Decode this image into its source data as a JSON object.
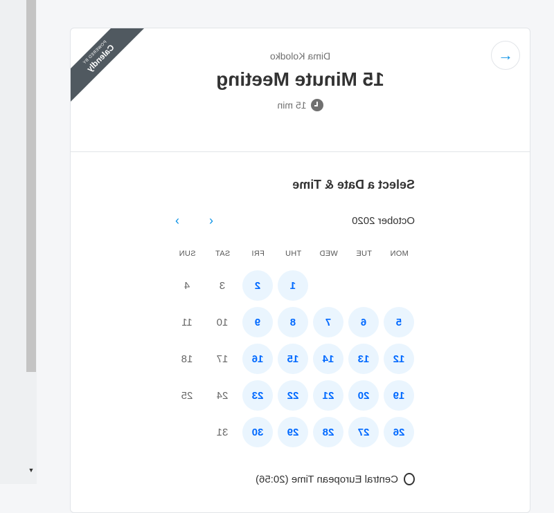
{
  "header": {
    "host": "Dima Kolodko",
    "title": "15 Minute Meeting",
    "duration": "15 min"
  },
  "ribbon": {
    "small": "POWERED BY",
    "brand": "Calendly"
  },
  "picker": {
    "title": "Select a Date & Time",
    "month": "October 2020",
    "weekdays": [
      "MON",
      "TUE",
      "WED",
      "THU",
      "FRI",
      "SAT",
      "SUN"
    ]
  },
  "days": [
    {
      "n": "1",
      "col": 3,
      "row": 0,
      "avail": true
    },
    {
      "n": "2",
      "col": 4,
      "row": 0,
      "avail": true
    },
    {
      "n": "3",
      "col": 5,
      "row": 0,
      "avail": false
    },
    {
      "n": "4",
      "col": 6,
      "row": 0,
      "avail": false
    },
    {
      "n": "5",
      "col": 0,
      "row": 1,
      "avail": true
    },
    {
      "n": "6",
      "col": 1,
      "row": 1,
      "avail": true
    },
    {
      "n": "7",
      "col": 2,
      "row": 1,
      "avail": true
    },
    {
      "n": "8",
      "col": 3,
      "row": 1,
      "avail": true
    },
    {
      "n": "9",
      "col": 4,
      "row": 1,
      "avail": true
    },
    {
      "n": "10",
      "col": 5,
      "row": 1,
      "avail": false
    },
    {
      "n": "11",
      "col": 6,
      "row": 1,
      "avail": false
    },
    {
      "n": "12",
      "col": 0,
      "row": 2,
      "avail": true
    },
    {
      "n": "13",
      "col": 1,
      "row": 2,
      "avail": true
    },
    {
      "n": "14",
      "col": 2,
      "row": 2,
      "avail": true
    },
    {
      "n": "15",
      "col": 3,
      "row": 2,
      "avail": true
    },
    {
      "n": "16",
      "col": 4,
      "row": 2,
      "avail": true
    },
    {
      "n": "17",
      "col": 5,
      "row": 2,
      "avail": false
    },
    {
      "n": "18",
      "col": 6,
      "row": 2,
      "avail": false
    },
    {
      "n": "19",
      "col": 0,
      "row": 3,
      "avail": true
    },
    {
      "n": "20",
      "col": 1,
      "row": 3,
      "avail": true
    },
    {
      "n": "21",
      "col": 2,
      "row": 3,
      "avail": true
    },
    {
      "n": "22",
      "col": 3,
      "row": 3,
      "avail": true
    },
    {
      "n": "23",
      "col": 4,
      "row": 3,
      "avail": true
    },
    {
      "n": "24",
      "col": 5,
      "row": 3,
      "avail": false
    },
    {
      "n": "25",
      "col": 6,
      "row": 3,
      "avail": false
    },
    {
      "n": "26",
      "col": 0,
      "row": 4,
      "avail": true
    },
    {
      "n": "27",
      "col": 1,
      "row": 4,
      "avail": true
    },
    {
      "n": "28",
      "col": 2,
      "row": 4,
      "avail": true
    },
    {
      "n": "29",
      "col": 3,
      "row": 4,
      "avail": true
    },
    {
      "n": "30",
      "col": 4,
      "row": 4,
      "avail": true
    },
    {
      "n": "31",
      "col": 5,
      "row": 4,
      "avail": false
    }
  ],
  "timezone": {
    "label": "Central European Time (20:56)",
    "icon": "globe-icon"
  },
  "colors": {
    "accent": "#0069ff",
    "available_bg": "#eaf5fe",
    "ribbon": "#505960"
  }
}
